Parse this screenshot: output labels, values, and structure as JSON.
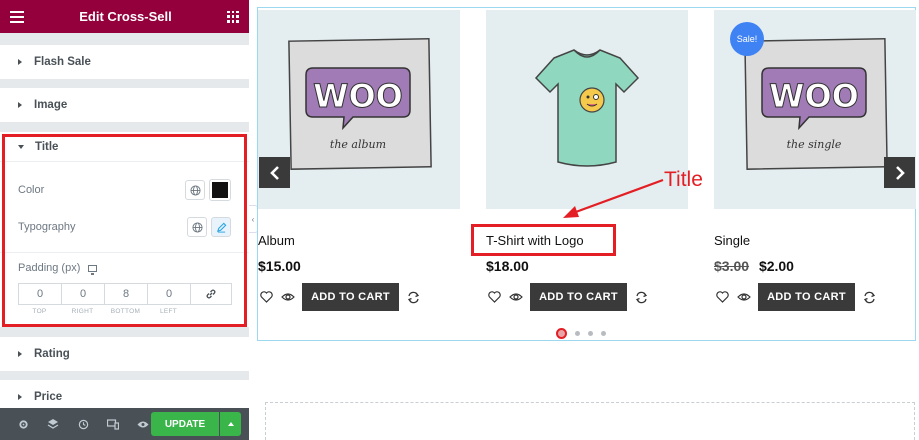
{
  "panel": {
    "title": "Edit Cross-Sell",
    "sections": {
      "flash_sale": "Flash Sale",
      "image": "Image",
      "title": "Title",
      "rating": "Rating",
      "price": "Price"
    },
    "title_controls": {
      "color_label": "Color",
      "color_value": "#111111",
      "typography_label": "Typography",
      "padding_label": "Padding (px)",
      "padding": {
        "top": "0",
        "right": "0",
        "bottom": "8",
        "left": "0"
      },
      "padding_captions": {
        "top": "TOP",
        "right": "RIGHT",
        "bottom": "BOTTOM",
        "left": "LEFT"
      }
    },
    "footer": {
      "update_label": "UPDATE",
      "icons": [
        "gear-icon",
        "layers-icon",
        "history-icon",
        "responsive-icon",
        "eye-icon"
      ]
    }
  },
  "products": [
    {
      "name": "Album",
      "price": "$15.00",
      "old_price": "",
      "button": "ADD TO CART",
      "image_text": "WOO",
      "image_subtext": "the album"
    },
    {
      "name": "T-Shirt with Logo",
      "price": "$18.00",
      "old_price": "",
      "button": "ADD TO CART"
    },
    {
      "name": "Single",
      "price": "$2.00",
      "old_price": "$3.00",
      "button": "ADD TO CART",
      "badge": "Sale!",
      "image_text": "WOO",
      "image_subtext": "the single"
    }
  ],
  "annotation": {
    "label": "Title"
  },
  "colors": {
    "panel_header": "#93003c",
    "update_button": "#39b54a",
    "annotation": "#e31e24",
    "sale_badge": "#3f82f3"
  }
}
